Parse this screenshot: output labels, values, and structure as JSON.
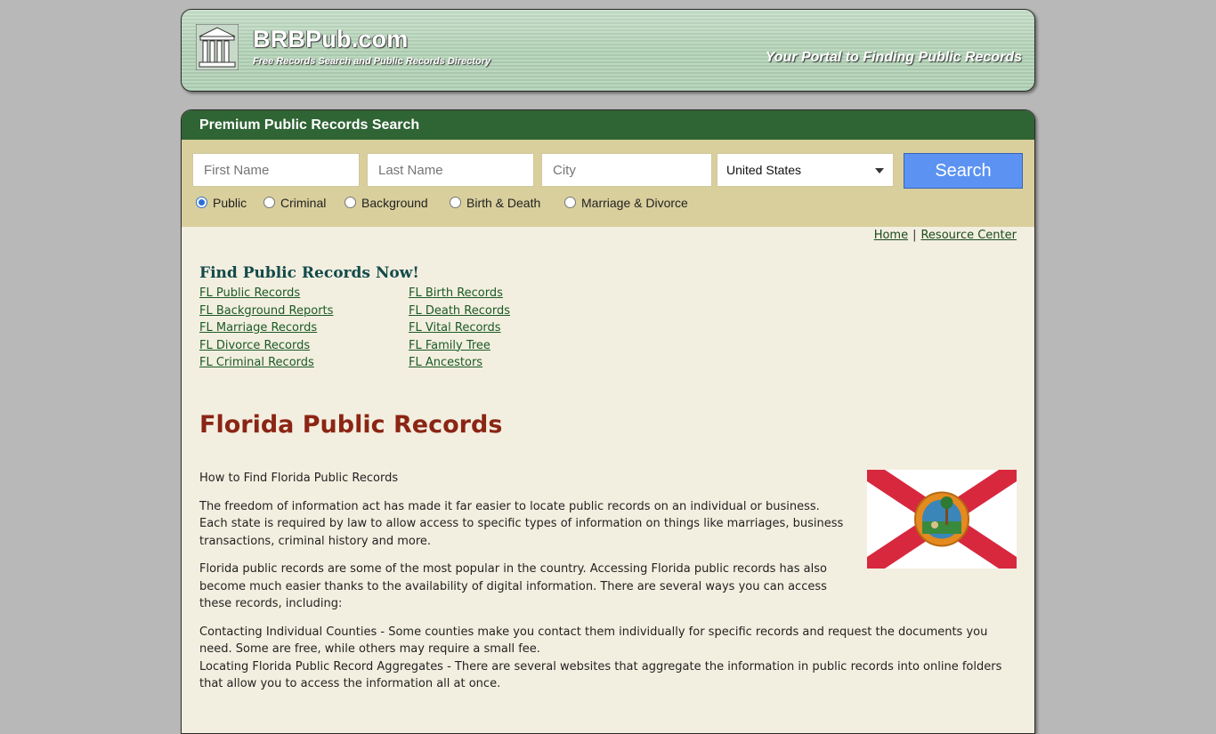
{
  "header": {
    "brand": "BRBPub.com",
    "tagline": "Free Records Search and Public Records Directory",
    "portal": "Your Portal to Finding Public Records"
  },
  "search": {
    "panel_title": "Premium Public Records Search",
    "first_name_placeholder": "First Name",
    "last_name_placeholder": "Last Name",
    "city_placeholder": "City",
    "country_selected": "United States",
    "button_label": "Search",
    "record_types": [
      {
        "label": "Public",
        "checked": true
      },
      {
        "label": "Criminal",
        "checked": false
      },
      {
        "label": "Background",
        "checked": false
      },
      {
        "label": "Birth & Death",
        "checked": false
      },
      {
        "label": "Marriage & Divorce",
        "checked": false
      }
    ]
  },
  "nav": {
    "home": "Home",
    "separator": "|",
    "resource_center": "Resource Center"
  },
  "find": {
    "title": "Find Public Records Now!",
    "left_links": [
      "FL Public Records",
      "FL Background Reports",
      "FL Marriage Records",
      "FL Divorce Records",
      "FL Criminal Records"
    ],
    "right_links": [
      "FL Birth Records",
      "FL Death Records",
      "FL Vital Records",
      "FL Family Tree",
      "FL Ancestors"
    ]
  },
  "article": {
    "title": "Florida Public Records",
    "intro": "How to Find Florida Public Records",
    "para1": "The freedom of information act has made it far easier to locate public records on an individual or business. Each state is required by law to allow access to specific types of information on things like marriages, business transactions, criminal history and more.",
    "para2": "Florida public records are some of the most popular in the country. Accessing Florida public records has also become much easier thanks to the availability of digital information. There are several ways you can access these records, including:",
    "para3": "Contacting Individual Counties - Some counties make you contact them individually for specific records and request the documents you need. Some are free, while others may require a small fee.",
    "para4": "Locating Florida Public Record Aggregates - There are several websites that aggregate the information in public records into online folders that allow you to access the information all at once."
  },
  "colors": {
    "panel_header": "#2f6434",
    "search_bg": "#d9cf9c",
    "content_bg": "#f3efe0",
    "heading_red": "#8b2514",
    "search_button": "#5c93f2",
    "flag_red": "#d7283e"
  }
}
